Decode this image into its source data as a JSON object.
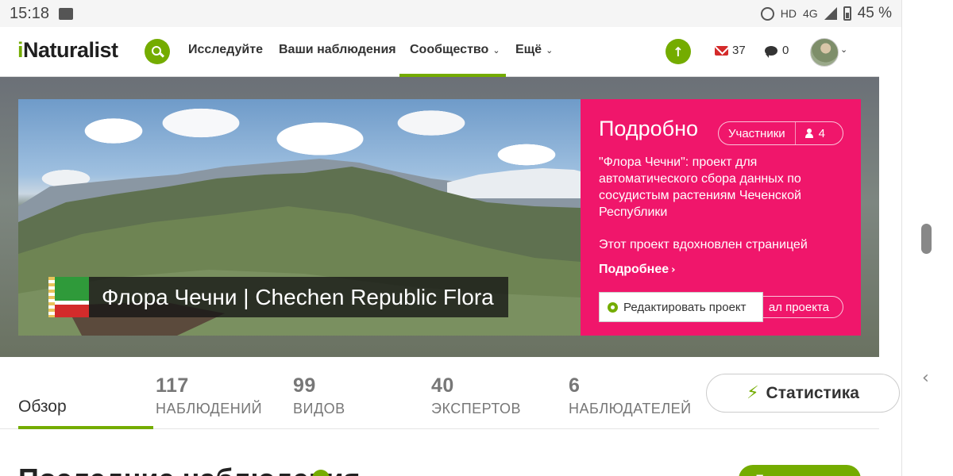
{
  "status_bar": {
    "time": "15:18",
    "hd": "HD",
    "network": "4G",
    "battery": "45 %"
  },
  "header": {
    "logo_prefix": "i",
    "logo_rest": "Naturalist",
    "nav": [
      {
        "label": "Исследуйте"
      },
      {
        "label": "Ваши наблюдения"
      },
      {
        "label": "Сообщество"
      },
      {
        "label": "Ещё"
      }
    ],
    "messages_count": "37",
    "comments_count": "0"
  },
  "project": {
    "title": "Флора Чечни | Chechen Republic Flora"
  },
  "details": {
    "heading": "Подробно",
    "members_label": "Участники",
    "members_count": "4",
    "description": "\"Флора Чечни\": проект для автоматического сбора данных по сосудистым растениям Чеченской Республики",
    "inspired": "Этот проект вдохновлен страницей",
    "more": "Подробнее",
    "journal": "ал проекта",
    "edit": "Редактировать проект"
  },
  "stats": {
    "tab_overview": "Обзор",
    "items": [
      {
        "num": "117",
        "label": "НАБЛЮДЕНИЙ"
      },
      {
        "num": "99",
        "label": "ВИДОВ"
      },
      {
        "num": "40",
        "label": "ЭКСПЕРТОВ"
      },
      {
        "num": "6",
        "label": "НАБЛЮДАТЕЛЕЙ"
      }
    ],
    "stats_button": "Статистика"
  },
  "recent": {
    "heading": "Последние наблюдения",
    "show_all": "Посмотреть все"
  },
  "colors": {
    "brand_green": "#74ac00",
    "panel_pink": "#f0166b",
    "mail_red": "#d42a2a"
  },
  "icons": [
    "search-icon",
    "upload-icon",
    "mail-icon",
    "chat-icon",
    "user-icon",
    "gear-icon",
    "bolt-icon",
    "chevron-down-icon",
    "chevron-right-icon"
  ]
}
